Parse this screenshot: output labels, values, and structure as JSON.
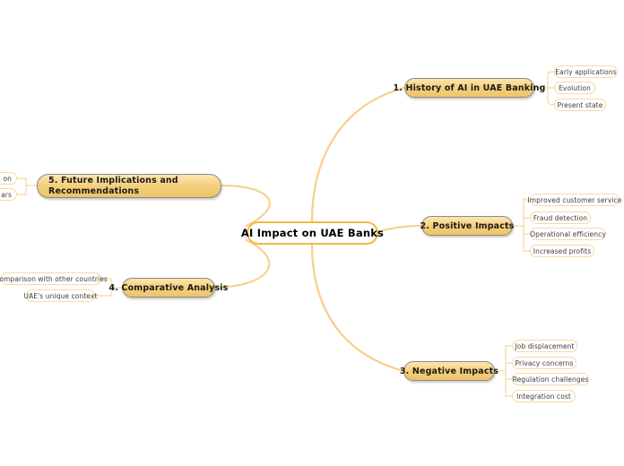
{
  "diagram": {
    "type": "mind-map",
    "background_color": "#ffffff",
    "accent_color": "#f5b940",
    "branch_fill_color": "#f4d07e",
    "leaf_border_color": "#f7d9a8",
    "connector_color": "#f7cf8a"
  },
  "root": {
    "label": "AI Impact on UAE Banks"
  },
  "branches": [
    {
      "id": "history",
      "label": "1. History of AI in UAE Banking",
      "side": "right",
      "leaves": [
        {
          "label": "Early applications"
        },
        {
          "label": "Evolution"
        },
        {
          "label": "Present state"
        }
      ]
    },
    {
      "id": "positive",
      "label": "2. Positive Impacts",
      "side": "right",
      "leaves": [
        {
          "label": "Improved customer service"
        },
        {
          "label": "Fraud detection"
        },
        {
          "label": "Operational efficiency"
        },
        {
          "label": "Increased profits"
        }
      ]
    },
    {
      "id": "negative",
      "label": "3. Negative Impacts",
      "side": "right",
      "leaves": [
        {
          "label": "Job displacement"
        },
        {
          "label": "Privacy concerns"
        },
        {
          "label": "Regulation challenges"
        },
        {
          "label": "Integration cost"
        }
      ]
    },
    {
      "id": "comparative",
      "label": "4. Comparative Analysis",
      "side": "left",
      "leaves": [
        {
          "label": "Comparison with other countries"
        },
        {
          "label": "UAE's unique context"
        }
      ]
    },
    {
      "id": "future",
      "label": "5. Future Implications and Recommendations",
      "side": "left",
      "leaves": [
        {
          "label": "on"
        },
        {
          "label": "ars"
        }
      ]
    }
  ]
}
